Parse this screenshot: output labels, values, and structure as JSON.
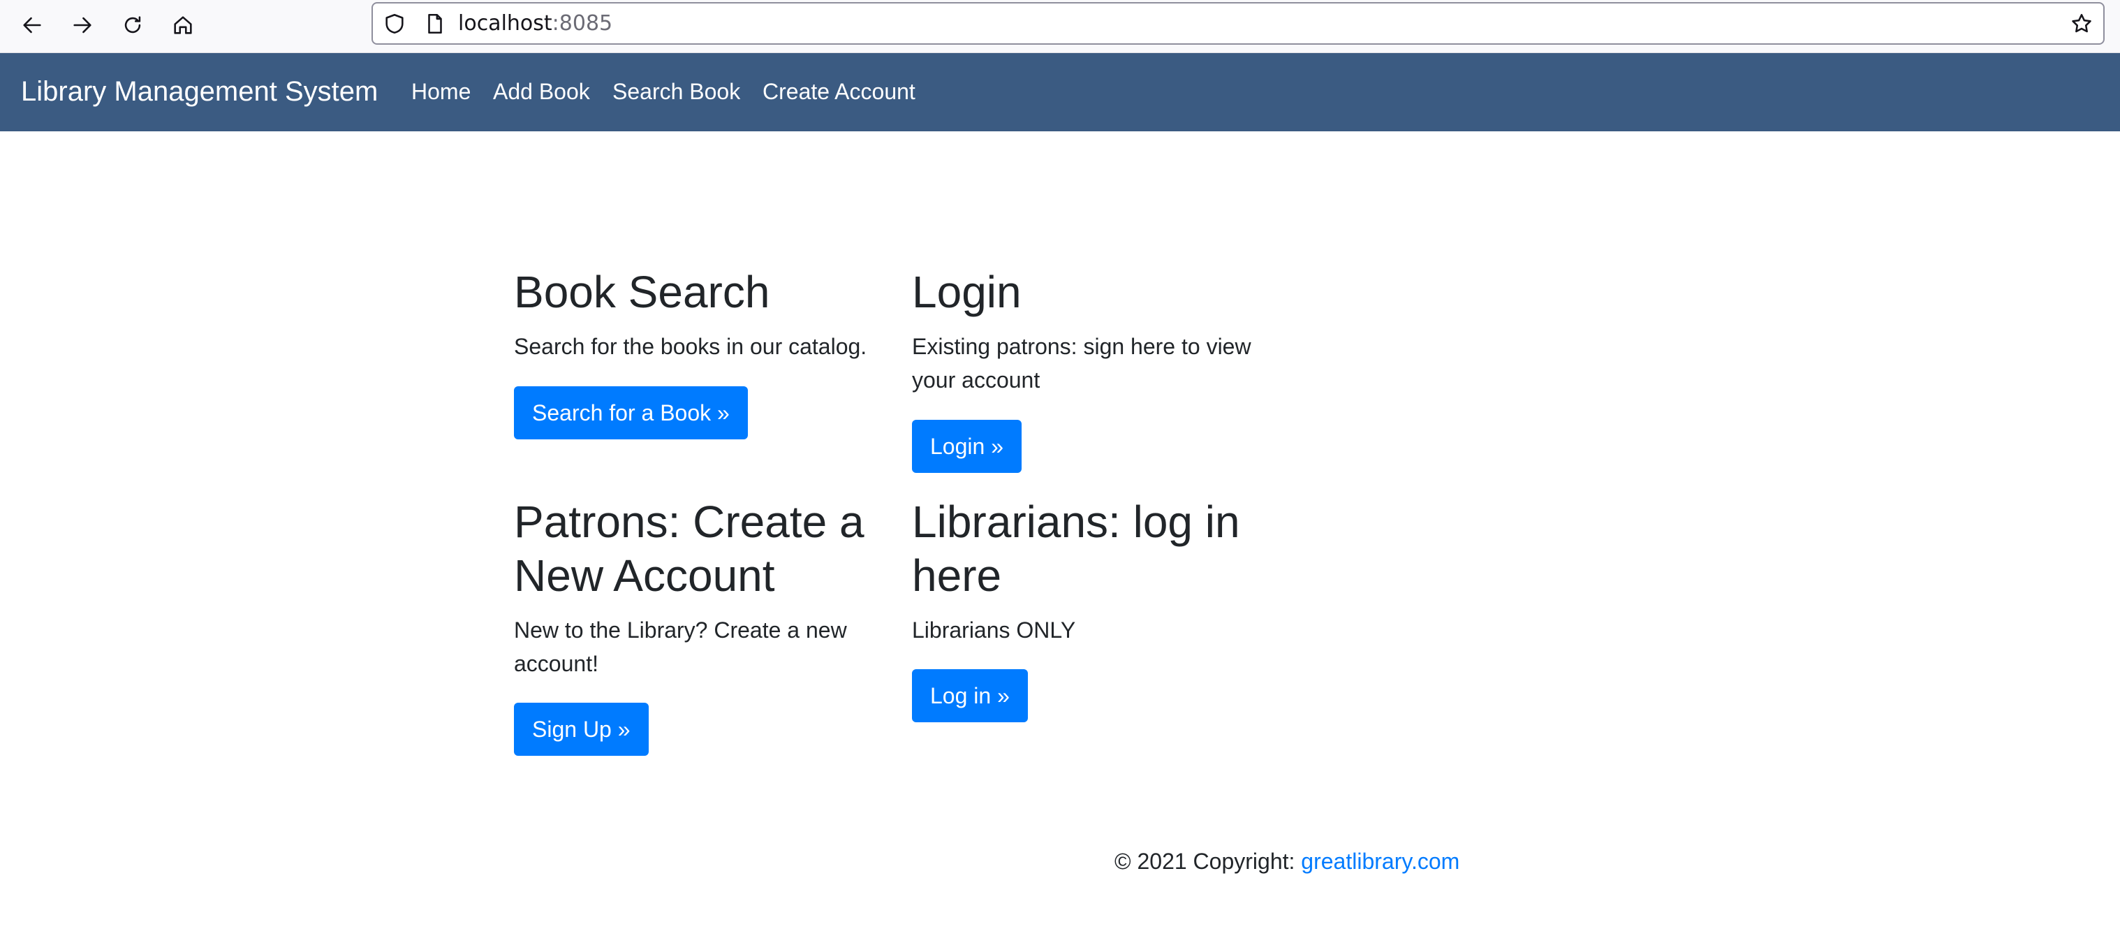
{
  "browser": {
    "url_host": "localhost",
    "url_port": ":8085",
    "icons": [
      "back-icon",
      "forward-icon",
      "reload-icon",
      "home-icon",
      "shield-icon",
      "page-icon",
      "bookmark-star-icon"
    ]
  },
  "navbar": {
    "brand": "Library Management System",
    "links": [
      "Home",
      "Add Book",
      "Search Book",
      "Create Account"
    ],
    "background": "#3b5b82"
  },
  "cards": {
    "book_search": {
      "title": "Book Search",
      "text": "Search for the books in our catalog.",
      "button": "Search for a Book »"
    },
    "login": {
      "title": "Login",
      "text_line1": "Existing patrons: sign here to view",
      "text_line2": "your account",
      "button": "Login »"
    },
    "patrons": {
      "title_line1": "Patrons: Create a",
      "title_line2": "New Account",
      "text_line1": "New to the Library? Create a new",
      "text_line2": "account!",
      "button": "Sign Up »"
    },
    "librarians": {
      "title_line1": "Librarians: log in",
      "title_line2": "here",
      "text": "Librarians ONLY",
      "button": "Log in »"
    }
  },
  "footer": {
    "copyright": "© 2021 Copyright: ",
    "link": "greatlibrary.com"
  },
  "colors": {
    "primary_button": "#007bff",
    "link": "#007bff"
  }
}
